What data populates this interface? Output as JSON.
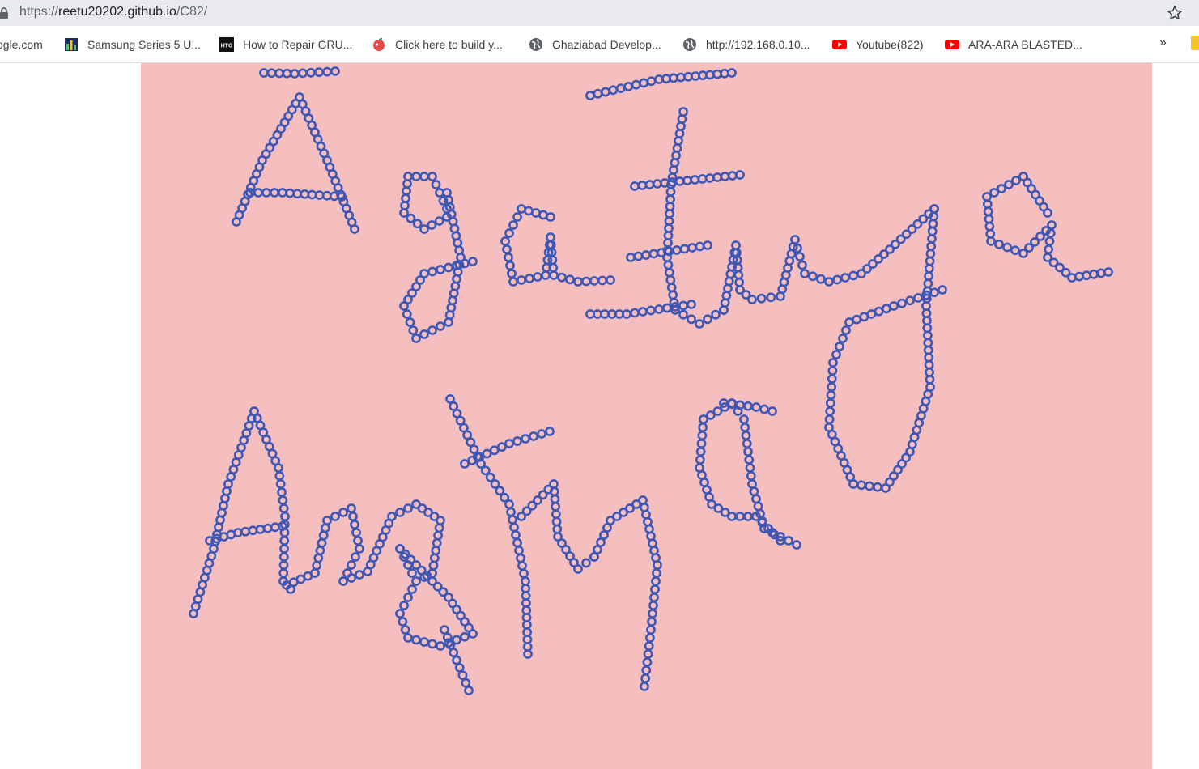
{
  "browser": {
    "url_prefix": "https://",
    "url_host": "reetu20202.github.io",
    "url_path": "/C82/",
    "bookmarks": [
      {
        "label": "ogle.com",
        "icon": "none"
      },
      {
        "label": "Samsung Series 5 U...",
        "icon": "chart-favicon"
      },
      {
        "label": "How to Repair GRU...",
        "icon": "htg-favicon"
      },
      {
        "label": "Click here to build y...",
        "icon": "red-apple-favicon"
      },
      {
        "label": "Ghaziabad Develop...",
        "icon": "globe-icon"
      },
      {
        "label": "http://192.168.0.10...",
        "icon": "globe-icon"
      },
      {
        "label": "Youtube(822)",
        "icon": "youtube-icon"
      },
      {
        "label": "ARA-ARA BLASTED...",
        "icon": "youtube-icon"
      }
    ],
    "more_label": "»"
  },
  "canvas": {
    "background": "#f6bfbf",
    "stroke_color": "#3e57b5"
  }
}
